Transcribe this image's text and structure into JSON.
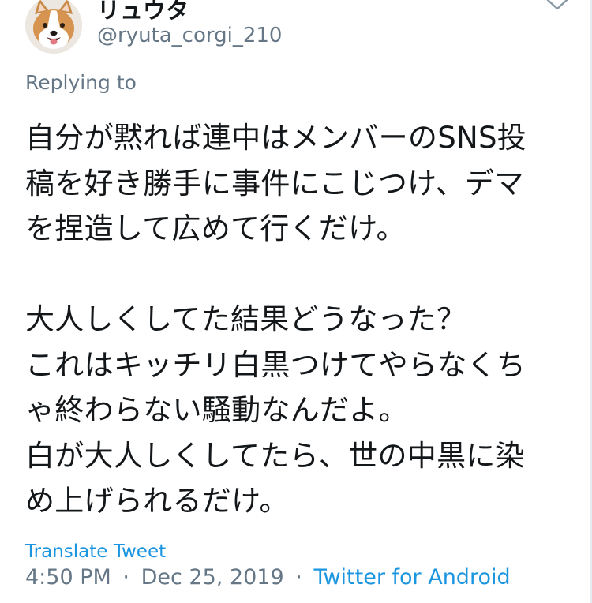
{
  "author": {
    "display_name": "リュウタ",
    "handle": "@ryuta_corgi_210",
    "avatar": "corgi-avatar"
  },
  "reply_context": {
    "label": "Replying to"
  },
  "tweet": {
    "lines": [
      "自分が黙れば連中はメンバーのSNS投",
      "稿を好き勝手に事件にこじつけ、デマ",
      "を捏造して広めて行くだけ。",
      "",
      "大人しくしてた結果どうなった？",
      "これはキッチリ白黒つけてやらなくち",
      "ゃ終わらない騒動なんだよ。",
      "白が大人しくしてたら、世の中黒に染",
      "め上げられるだけ。"
    ]
  },
  "translate_label": "Translate Tweet",
  "meta": {
    "time": "4:50 PM",
    "separator": "·",
    "date": "Dec 25, 2019",
    "source": "Twitter for Android"
  },
  "icons": {
    "menu": "chevron-down-icon"
  },
  "colors": {
    "text": "#14171a",
    "secondary": "#657786",
    "link": "#1b95e0"
  }
}
